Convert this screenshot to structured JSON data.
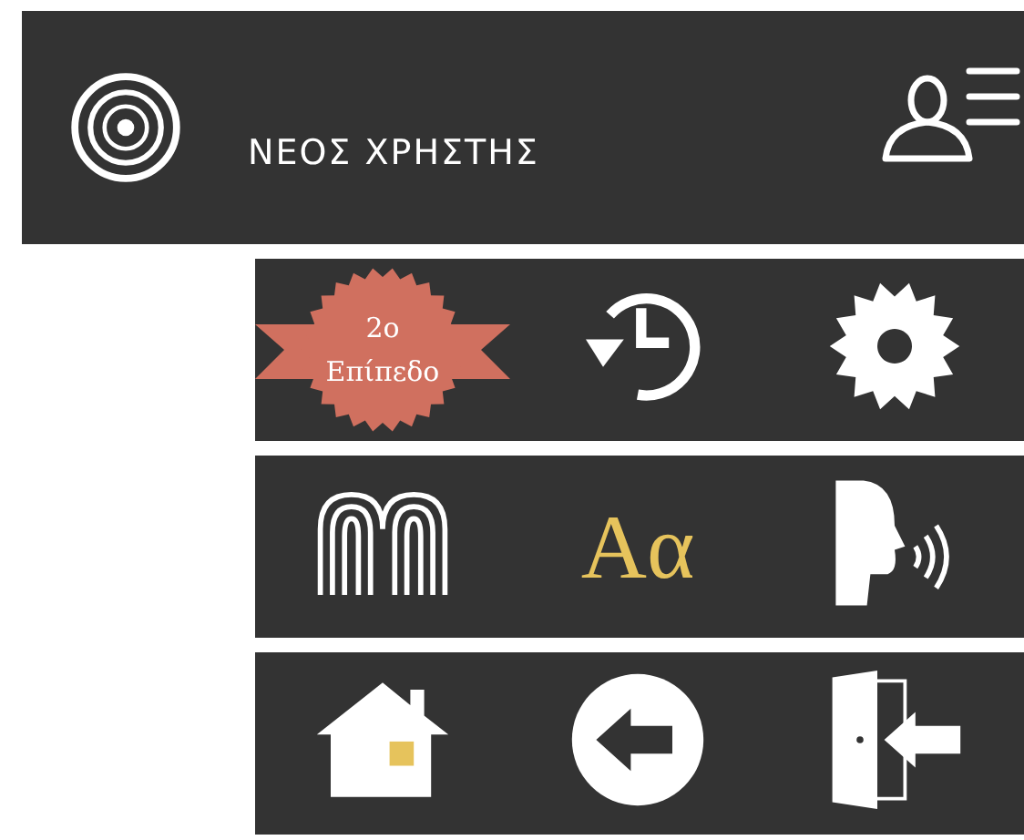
{
  "header": {
    "title": "ΝΕΟΣ ΧΡΗΣΤΗΣ"
  },
  "rows": [
    {
      "cells": [
        {
          "kind": "badge",
          "line1": "2ο",
          "line2": "Επίπεδο"
        },
        {
          "kind": "history"
        },
        {
          "kind": "settings"
        }
      ]
    },
    {
      "cells": [
        {
          "kind": "arches"
        },
        {
          "kind": "font",
          "label": "Aα"
        },
        {
          "kind": "speech"
        }
      ]
    },
    {
      "cells": [
        {
          "kind": "home"
        },
        {
          "kind": "back"
        },
        {
          "kind": "exit"
        }
      ]
    }
  ]
}
